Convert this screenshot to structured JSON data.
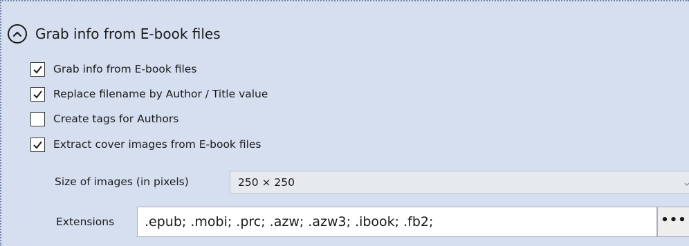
{
  "section": {
    "title": "Grab info from E-book files",
    "collapse_icon": "chevron-up-circle-icon"
  },
  "options": [
    {
      "label": "Grab info from E-book files",
      "checked": true
    },
    {
      "label": "Replace filename by Author / Title value",
      "checked": true
    },
    {
      "label": "Create tags for Authors",
      "checked": false
    },
    {
      "label": "Extract cover images from E-book files",
      "checked": true
    }
  ],
  "image_size": {
    "label": "Size of images (in pixels)",
    "value": "250 × 250",
    "arrow_icon": "chevron-down-icon"
  },
  "extensions": {
    "label": "Extensions",
    "value": ".epub; .mobi; .prc; .azw; .azw3; .ibook; .fb2;",
    "browse_label": "•••"
  },
  "colors": {
    "panel_background": "#d5dff0",
    "panel_border": "#6f84a8"
  }
}
